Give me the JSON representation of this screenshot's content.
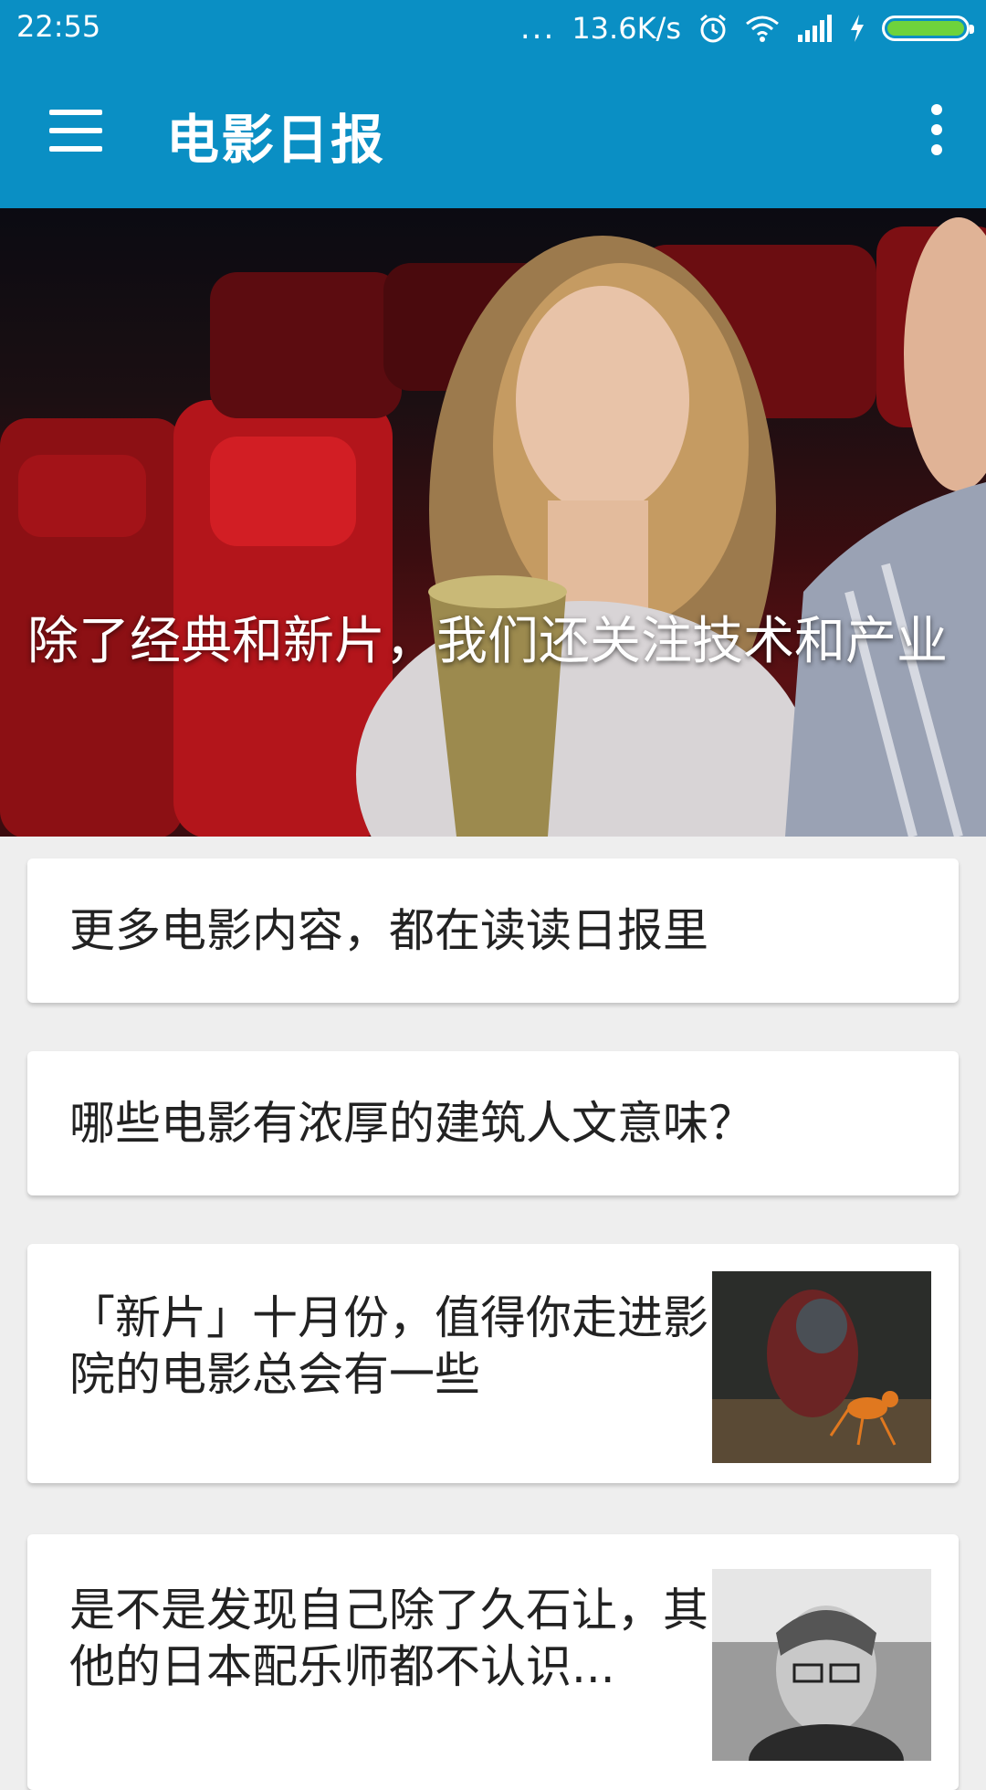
{
  "status_bar": {
    "time": "22:55",
    "dots": "...",
    "speed": "13.6K/s",
    "icons": [
      "alarm-icon",
      "wifi-icon",
      "signal-icon",
      "charging-icon",
      "battery-icon"
    ]
  },
  "app_bar": {
    "title": "电影日报",
    "menu_icon": "menu-icon",
    "overflow_icon": "more-vert-icon"
  },
  "hero": {
    "caption": "除了经典和新片，我们还关注技术和产业"
  },
  "articles": [
    {
      "title": "更多电影内容，都在读读日报里"
    },
    {
      "title": "哪些电影有浓厚的建筑人文意味？"
    },
    {
      "title": "「新片」十月份，值得你走进影院的电影总会有一些"
    },
    {
      "title": "是不是发现自己除了久石让，其他的日本配乐师都不认识..."
    }
  ],
  "colors": {
    "primary": "#0a8fc4",
    "background": "#eeeeee"
  }
}
